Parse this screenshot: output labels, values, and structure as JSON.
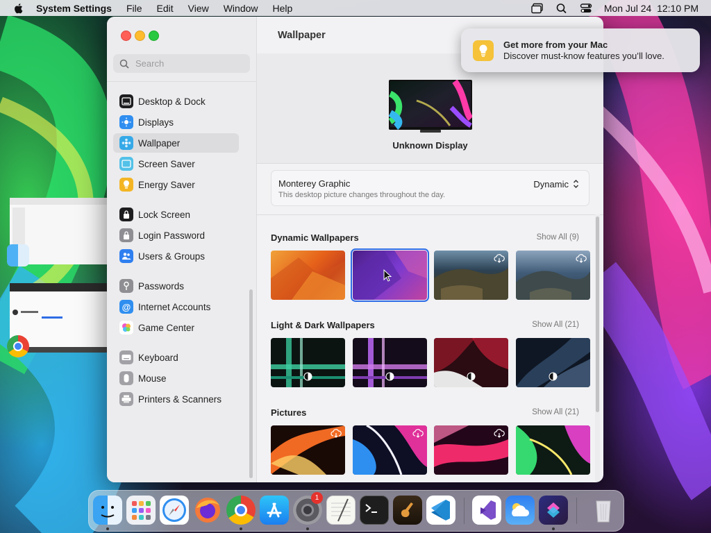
{
  "menubar": {
    "app_name": "System Settings",
    "menus": [
      "File",
      "Edit",
      "View",
      "Window",
      "Help"
    ],
    "datetime": "Mon Jul 24  12:10 PM"
  },
  "sidebar": {
    "search_placeholder": "Search",
    "groups": [
      [
        {
          "label": "Desktop & Dock",
          "icon": "desktop-dock-icon",
          "color": "#1d1d1f"
        },
        {
          "label": "Displays",
          "icon": "displays-icon",
          "color": "#2f8ef0"
        },
        {
          "label": "Wallpaper",
          "icon": "wallpaper-icon",
          "color": "#35a9e8"
        },
        {
          "label": "Screen Saver",
          "icon": "screen-saver-icon",
          "color": "#53c1e8"
        },
        {
          "label": "Energy Saver",
          "icon": "energy-saver-icon",
          "color": "#f4b525"
        }
      ],
      [
        {
          "label": "Lock Screen",
          "icon": "lock-screen-icon",
          "color": "#1d1d1f"
        },
        {
          "label": "Login Password",
          "icon": "login-password-icon",
          "color": "#8e8e93"
        },
        {
          "label": "Users & Groups",
          "icon": "users-groups-icon",
          "color": "#2f7ff0"
        }
      ],
      [
        {
          "label": "Passwords",
          "icon": "passwords-icon",
          "color": "#8e8e93"
        },
        {
          "label": "Internet Accounts",
          "icon": "internet-accounts-icon",
          "color": "#2f8ef0"
        },
        {
          "label": "Game Center",
          "icon": "game-center-icon",
          "color": "#ffffff"
        }
      ],
      [
        {
          "label": "Keyboard",
          "icon": "keyboard-icon",
          "color": "#a1a1a6"
        },
        {
          "label": "Mouse",
          "icon": "mouse-icon",
          "color": "#a1a1a6"
        },
        {
          "label": "Printers & Scanners",
          "icon": "printers-scanners-icon",
          "color": "#a1a1a6"
        }
      ]
    ],
    "selected": "Wallpaper"
  },
  "main": {
    "title": "Wallpaper",
    "display_name": "Unknown Display",
    "current": {
      "name": "Monterey Graphic",
      "description": "This desktop picture changes throughout the day.",
      "mode": "Dynamic"
    },
    "sections": [
      {
        "title": "Dynamic Wallpapers",
        "show_all": "Show All (9)"
      },
      {
        "title": "Light & Dark Wallpapers",
        "show_all": "Show All (21)"
      },
      {
        "title": "Pictures",
        "show_all": "Show All (21)"
      }
    ]
  },
  "notification": {
    "title": "Get more from your Mac",
    "body": "Discover must-know features you’ll love."
  },
  "dock": {
    "apps": [
      "Finder",
      "Launchpad",
      "Safari",
      "Firefox",
      "Chrome",
      "App Store",
      "System Settings",
      "TextEdit",
      "Terminal",
      "GarageBand",
      "Visual Studio Code",
      "Visual Studio",
      "Weather",
      "Shortcuts",
      "Trash"
    ],
    "settings_badge": "1"
  },
  "colors": {
    "accent": "#2e6ce6",
    "sidebar_bg": "#ececee",
    "window_bg": "#f2f2f4"
  }
}
